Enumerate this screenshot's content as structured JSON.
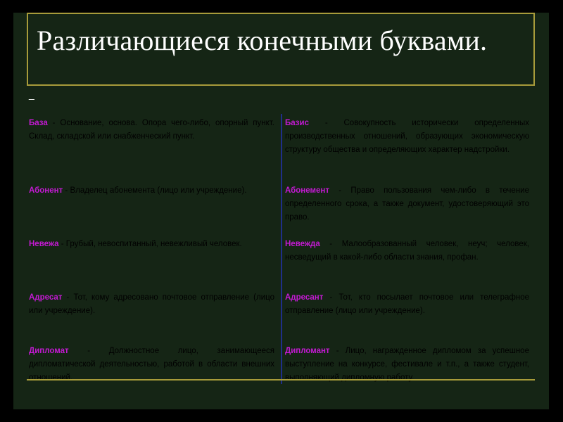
{
  "title": "Различающиеся конечными буквами.",
  "title_mark": "_",
  "colors": {
    "background": "#152515",
    "frame": "#a79b3a",
    "term": "#c31ad2",
    "divider": "#1f2f8a"
  },
  "pairs": [
    {
      "left": {
        "term": "База",
        "sep": " - ",
        "definition": "Основание, основа. Опора чего-либо, опорный пункт. Склад, складской или снабженческий пункт."
      },
      "right": {
        "term": "Базис",
        "sep": " - ",
        "definition": "Совокупность исторически определенных производственных отношений, образующих экономическую структуру общества и определяющих характер надстройки."
      }
    },
    {
      "left": {
        "term": "Абонент",
        "sep": " - ",
        "definition": "Владелец абонемента (лицо или учреждение)."
      },
      "right": {
        "term": "Абонемент",
        "sep": " - ",
        "definition": "Право пользования чем-либо в течение определенного срока, а также документ, удостоверяющий это право."
      }
    },
    {
      "left": {
        "term": "Невежа",
        "sep": " - ",
        "definition": "Грубый, невоспитанный, невежливый человек."
      },
      "right": {
        "term": "Невежда",
        "sep": " - ",
        "definition": "Малообразованный человек, неуч; человек, несведущий в какой-либо области знания, профан."
      }
    },
    {
      "left": {
        "term": "Адресат",
        "sep": " - ",
        "definition": "Тот, кому адресовано почтовое отправление (лицо или учреждение)."
      },
      "right": {
        "term": "Адресант",
        "sep": " - ",
        "definition": "Тот, кто посылает почтовое или телеграфное отправление (лицо или учреждение)."
      }
    },
    {
      "left": {
        "term": "Дипломат",
        "sep": " - ",
        "definition": "Должностное лицо, занимающееся дипломатической деятельностью, работой в области внешних отношений."
      },
      "right": {
        "term": "Дипломант",
        "sep": " - ",
        "definition": "Лицо, награжденное дипломом за успешное выступление на конкурсе, фестивале и т.п., а также студент, выполняющий дипломную работу."
      }
    }
  ]
}
